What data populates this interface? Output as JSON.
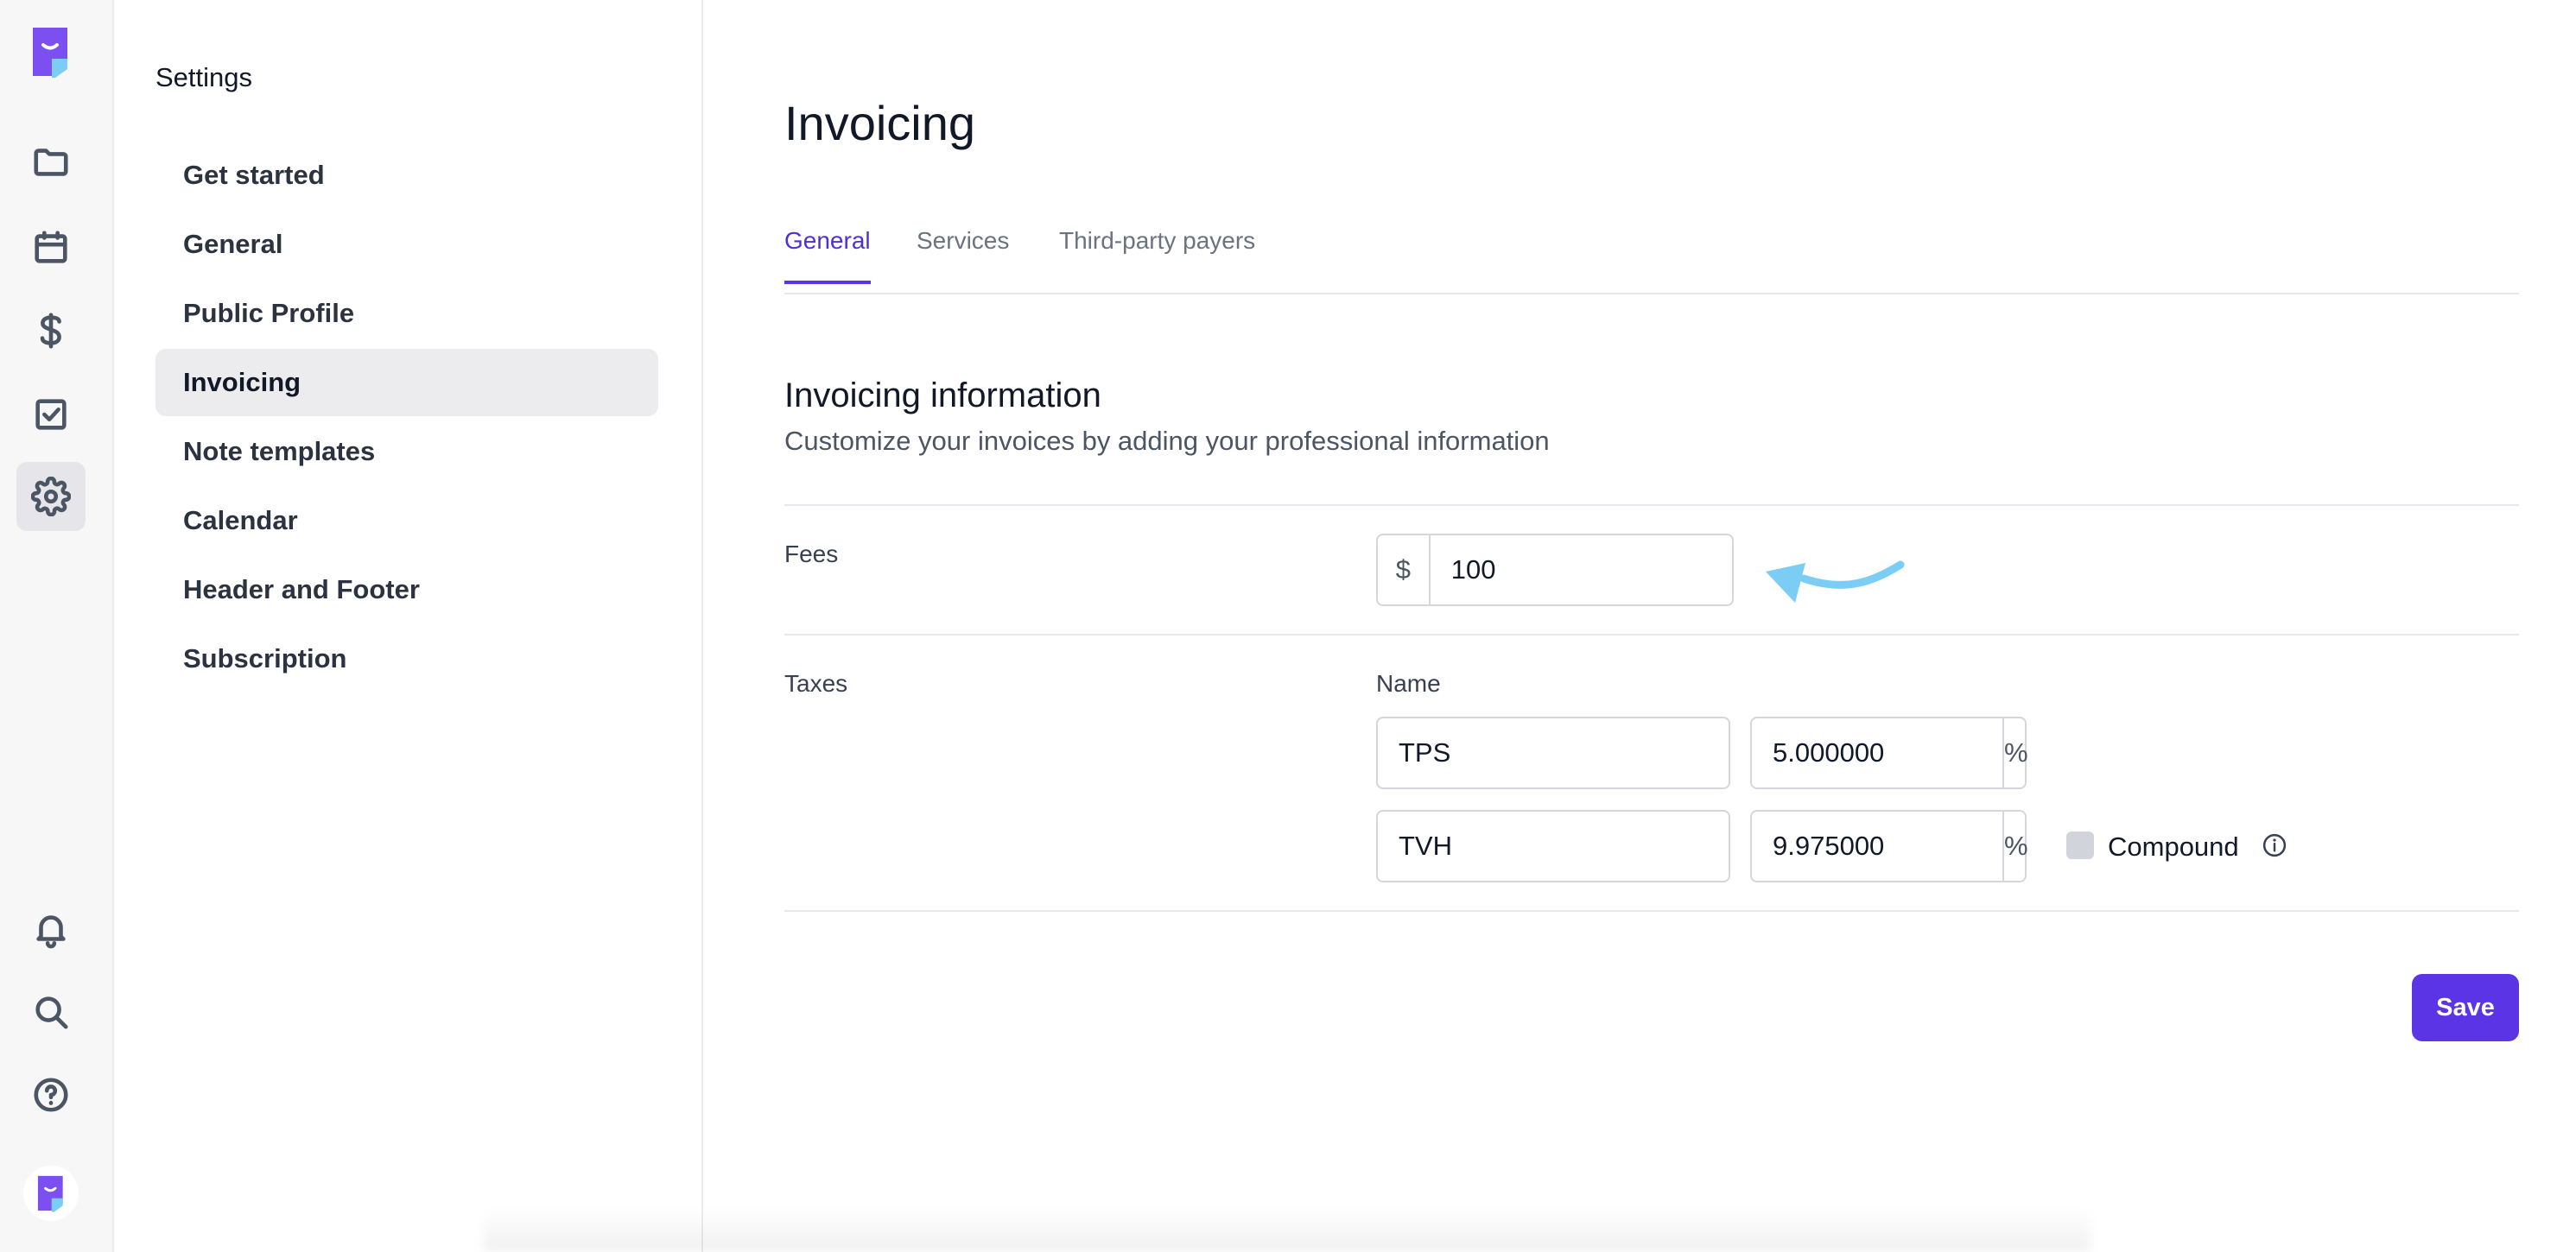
{
  "settings": {
    "title": "Settings",
    "items": [
      {
        "label": "Get started"
      },
      {
        "label": "General"
      },
      {
        "label": "Public Profile"
      },
      {
        "label": "Invoicing"
      },
      {
        "label": "Note templates"
      },
      {
        "label": "Calendar"
      },
      {
        "label": "Header and Footer"
      },
      {
        "label": "Subscription"
      }
    ],
    "active": "Invoicing"
  },
  "rail": {
    "icons": [
      "folder-icon",
      "calendar-icon",
      "dollar-icon",
      "checkbox-icon",
      "gear-icon",
      "bell-icon",
      "search-icon",
      "help-icon"
    ],
    "active": "gear-icon"
  },
  "main": {
    "title": "Invoicing",
    "tabs": [
      {
        "label": "General"
      },
      {
        "label": "Services"
      },
      {
        "label": "Third-party payers"
      }
    ],
    "active_tab": "General",
    "section": {
      "title": "Invoicing information",
      "subtitle": "Customize your invoices by adding your professional information"
    },
    "fees": {
      "label": "Fees",
      "currency_symbol": "$",
      "value": "100"
    },
    "taxes": {
      "label": "Taxes",
      "name_header": "Name",
      "rows": [
        {
          "name": "TPS",
          "rate": "5.000000",
          "unit": "%"
        },
        {
          "name": "TVH",
          "rate": "9.975000",
          "unit": "%",
          "compound_label": "Compound",
          "compound_checked": false
        }
      ]
    },
    "save_label": "Save"
  },
  "colors": {
    "accent": "#5b34e6",
    "arrow": "#7ccdf5",
    "logo": "#7b4ff0"
  }
}
